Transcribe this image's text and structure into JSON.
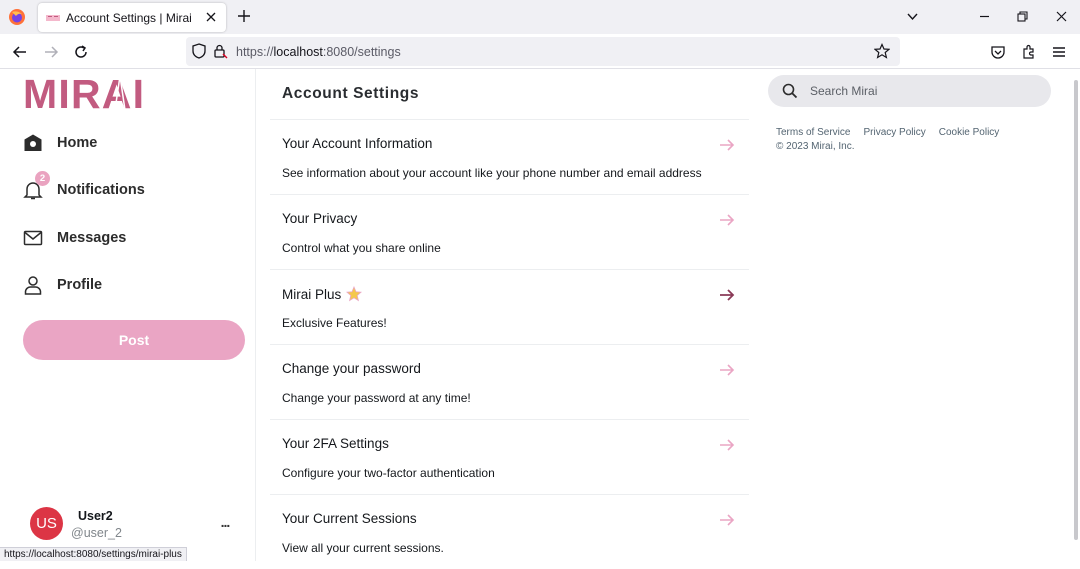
{
  "browser": {
    "tab_title": "Account Settings | Mirai",
    "url_scheme": "https://",
    "url_host": "localhost",
    "url_path": ":8080/settings",
    "status_url": "https://localhost:8080/settings/mirai-plus"
  },
  "brand": {
    "logo_text": "MIRAI",
    "accent_color": "#c25b80",
    "pink_light": "#eaa5c4"
  },
  "sidebar": {
    "items": [
      {
        "label": "Home",
        "icon": "home-icon"
      },
      {
        "label": "Notifications",
        "icon": "bell-icon",
        "badge": "2"
      },
      {
        "label": "Messages",
        "icon": "mail-icon"
      },
      {
        "label": "Profile",
        "icon": "user-icon"
      }
    ],
    "post_label": "Post",
    "user": {
      "initials": "US",
      "name": "User2",
      "handle": "@user_2",
      "more": "..."
    }
  },
  "main": {
    "title": "Account Settings",
    "settings": [
      {
        "title": "Your Account Information",
        "desc": "See information about your account like your phone number and email address"
      },
      {
        "title": "Your Privacy",
        "desc": "Control what you share online"
      },
      {
        "title": "Mirai Plus",
        "desc": "Exclusive Features!",
        "icon": "star-icon",
        "hovered": true
      },
      {
        "title": "Change your password",
        "desc": "Change your password at any time!"
      },
      {
        "title": "Your 2FA Settings",
        "desc": "Configure your two-factor authentication"
      },
      {
        "title": "Your Current Sessions",
        "desc": "View all your current sessions."
      }
    ]
  },
  "right": {
    "search_placeholder": "Search Mirai",
    "footer_links": [
      "Terms of Service",
      "Privacy Policy",
      "Cookie Policy"
    ],
    "copyright": "© 2023 Mirai, Inc."
  }
}
